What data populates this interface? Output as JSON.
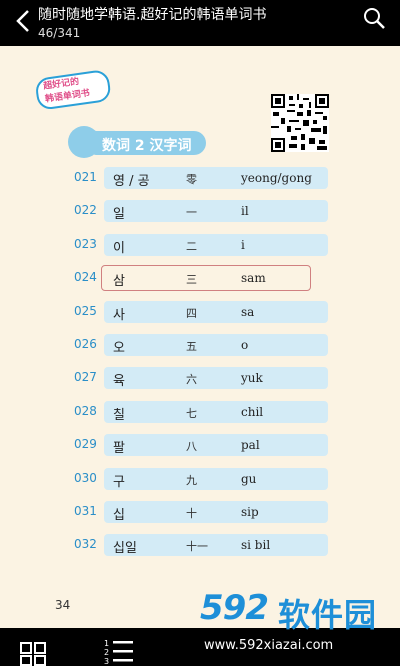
{
  "topbar": {
    "title": "随时随地学韩语.超好记的韩语单词书",
    "pages": "46/341"
  },
  "badge": {
    "line1": "超好记的",
    "line2": "韩语单词书"
  },
  "section": {
    "title": "数词 2  汉字词"
  },
  "rows": [
    {
      "num": "021",
      "kr": "영 / 공",
      "hz": "零",
      "rom": "yeong/gong"
    },
    {
      "num": "022",
      "kr": "일",
      "hz": "一",
      "rom": "il"
    },
    {
      "num": "023",
      "kr": "이",
      "hz": "二",
      "rom": "i"
    },
    {
      "num": "024",
      "kr": "삼",
      "hz": "三",
      "rom": "sam"
    },
    {
      "num": "025",
      "kr": "사",
      "hz": "四",
      "rom": "sa"
    },
    {
      "num": "026",
      "kr": "오",
      "hz": "五",
      "rom": "o"
    },
    {
      "num": "027",
      "kr": "육",
      "hz": "六",
      "rom": "yuk"
    },
    {
      "num": "028",
      "kr": "칠",
      "hz": "七",
      "rom": "chil"
    },
    {
      "num": "029",
      "kr": "팔",
      "hz": "八",
      "rom": "pal"
    },
    {
      "num": "030",
      "kr": "구",
      "hz": "九",
      "rom": "gu"
    },
    {
      "num": "031",
      "kr": "십",
      "hz": "十",
      "rom": "sip"
    },
    {
      "num": "032",
      "kr": "십일",
      "hz": "十一",
      "rom": "si bil"
    }
  ],
  "page_number": "34",
  "watermark": {
    "logo": "592",
    "name": "软件园",
    "url": "www.592xiazai.com"
  },
  "colors": {
    "accent": "#2a8ec8",
    "row_fill": "#d3ebf6",
    "header_fill": "#8ecde9",
    "page_bg": "#fbf3e3"
  }
}
